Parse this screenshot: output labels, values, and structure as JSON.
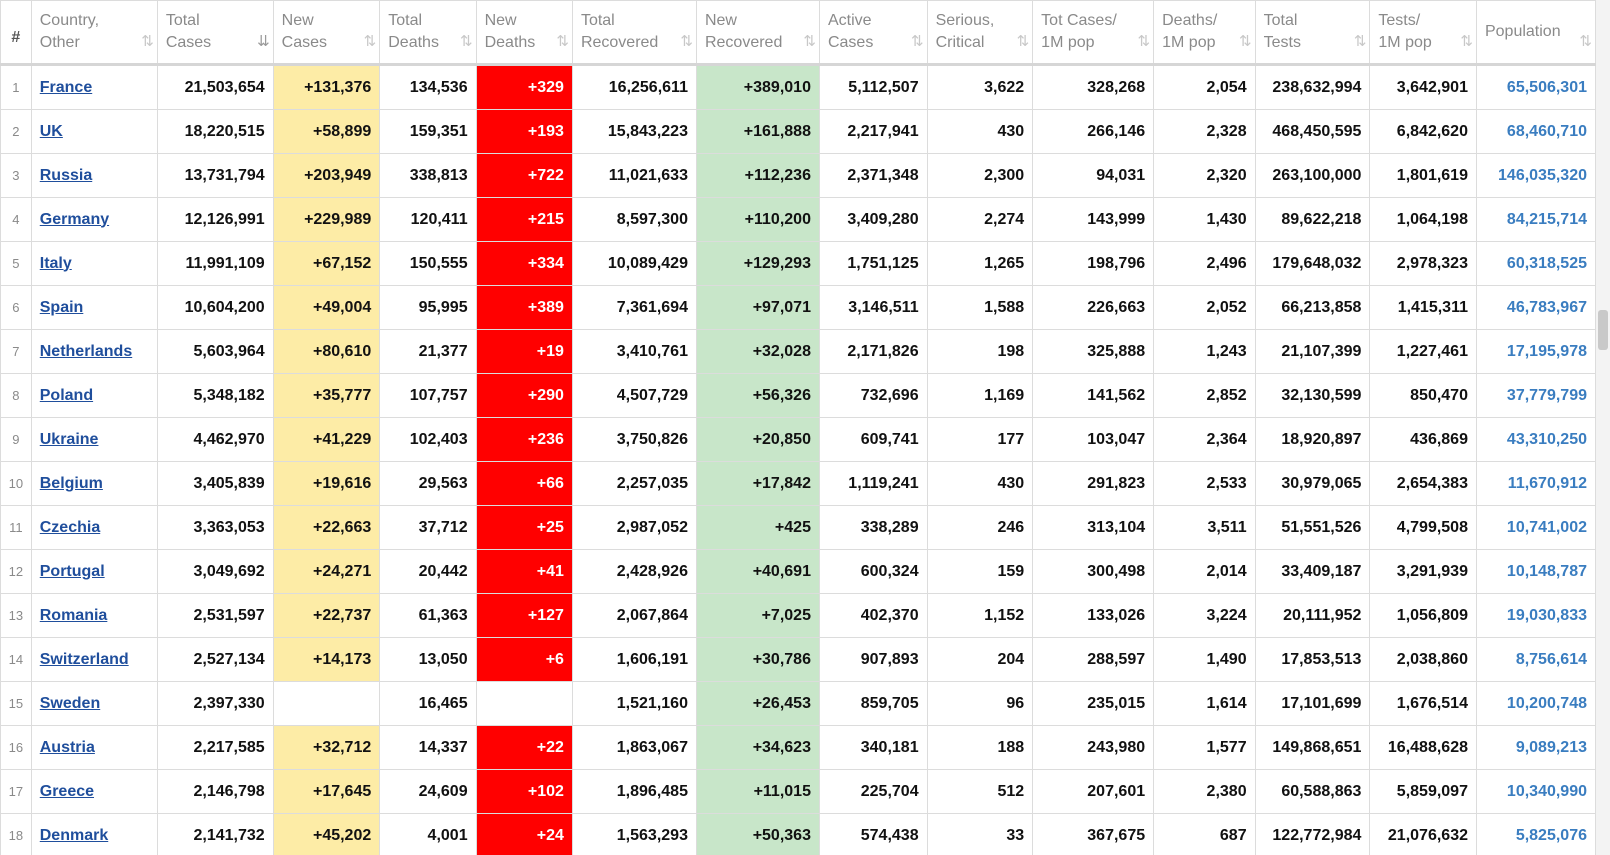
{
  "table": {
    "headers": [
      {
        "line1": "#",
        "line2": ""
      },
      {
        "line1": "Country,",
        "line2": "Other"
      },
      {
        "line1": "Total",
        "line2": "Cases"
      },
      {
        "line1": "New",
        "line2": "Cases"
      },
      {
        "line1": "Total",
        "line2": "Deaths"
      },
      {
        "line1": "New",
        "line2": "Deaths"
      },
      {
        "line1": "Total",
        "line2": "Recovered"
      },
      {
        "line1": "New",
        "line2": "Recovered"
      },
      {
        "line1": "Active",
        "line2": "Cases"
      },
      {
        "line1": "Serious,",
        "line2": "Critical"
      },
      {
        "line1": "Tot Cases/",
        "line2": "1M pop"
      },
      {
        "line1": "Deaths/",
        "line2": "1M pop"
      },
      {
        "line1": "Total",
        "line2": "Tests"
      },
      {
        "line1": "Tests/",
        "line2": "1M pop"
      },
      {
        "line1": "Population",
        "line2": ""
      }
    ],
    "sort_icon": "⇅",
    "active_sort_icon": "⇊",
    "active_sort_column": "Total Cases",
    "rows": [
      {
        "index": "1",
        "country": "France",
        "total_cases": "21,503,654",
        "new_cases": "+131,376",
        "total_deaths": "134,536",
        "new_deaths": "+329",
        "total_recovered": "16,256,611",
        "new_recovered": "+389,010",
        "active_cases": "5,112,507",
        "serious": "3,622",
        "cases_per_1m": "328,268",
        "deaths_per_1m": "2,054",
        "total_tests": "238,632,994",
        "tests_per_1m": "3,642,901",
        "population": "65,506,301"
      },
      {
        "index": "2",
        "country": "UK",
        "total_cases": "18,220,515",
        "new_cases": "+58,899",
        "total_deaths": "159,351",
        "new_deaths": "+193",
        "total_recovered": "15,843,223",
        "new_recovered": "+161,888",
        "active_cases": "2,217,941",
        "serious": "430",
        "cases_per_1m": "266,146",
        "deaths_per_1m": "2,328",
        "total_tests": "468,450,595",
        "tests_per_1m": "6,842,620",
        "population": "68,460,710"
      },
      {
        "index": "3",
        "country": "Russia",
        "total_cases": "13,731,794",
        "new_cases": "+203,949",
        "total_deaths": "338,813",
        "new_deaths": "+722",
        "total_recovered": "11,021,633",
        "new_recovered": "+112,236",
        "active_cases": "2,371,348",
        "serious": "2,300",
        "cases_per_1m": "94,031",
        "deaths_per_1m": "2,320",
        "total_tests": "263,100,000",
        "tests_per_1m": "1,801,619",
        "population": "146,035,320"
      },
      {
        "index": "4",
        "country": "Germany",
        "total_cases": "12,126,991",
        "new_cases": "+229,989",
        "total_deaths": "120,411",
        "new_deaths": "+215",
        "total_recovered": "8,597,300",
        "new_recovered": "+110,200",
        "active_cases": "3,409,280",
        "serious": "2,274",
        "cases_per_1m": "143,999",
        "deaths_per_1m": "1,430",
        "total_tests": "89,622,218",
        "tests_per_1m": "1,064,198",
        "population": "84,215,714"
      },
      {
        "index": "5",
        "country": "Italy",
        "total_cases": "11,991,109",
        "new_cases": "+67,152",
        "total_deaths": "150,555",
        "new_deaths": "+334",
        "total_recovered": "10,089,429",
        "new_recovered": "+129,293",
        "active_cases": "1,751,125",
        "serious": "1,265",
        "cases_per_1m": "198,796",
        "deaths_per_1m": "2,496",
        "total_tests": "179,648,032",
        "tests_per_1m": "2,978,323",
        "population": "60,318,525"
      },
      {
        "index": "6",
        "country": "Spain",
        "total_cases": "10,604,200",
        "new_cases": "+49,004",
        "total_deaths": "95,995",
        "new_deaths": "+389",
        "total_recovered": "7,361,694",
        "new_recovered": "+97,071",
        "active_cases": "3,146,511",
        "serious": "1,588",
        "cases_per_1m": "226,663",
        "deaths_per_1m": "2,052",
        "total_tests": "66,213,858",
        "tests_per_1m": "1,415,311",
        "population": "46,783,967"
      },
      {
        "index": "7",
        "country": "Netherlands",
        "total_cases": "5,603,964",
        "new_cases": "+80,610",
        "total_deaths": "21,377",
        "new_deaths": "+19",
        "total_recovered": "3,410,761",
        "new_recovered": "+32,028",
        "active_cases": "2,171,826",
        "serious": "198",
        "cases_per_1m": "325,888",
        "deaths_per_1m": "1,243",
        "total_tests": "21,107,399",
        "tests_per_1m": "1,227,461",
        "population": "17,195,978"
      },
      {
        "index": "8",
        "country": "Poland",
        "total_cases": "5,348,182",
        "new_cases": "+35,777",
        "total_deaths": "107,757",
        "new_deaths": "+290",
        "total_recovered": "4,507,729",
        "new_recovered": "+56,326",
        "active_cases": "732,696",
        "serious": "1,169",
        "cases_per_1m": "141,562",
        "deaths_per_1m": "2,852",
        "total_tests": "32,130,599",
        "tests_per_1m": "850,470",
        "population": "37,779,799"
      },
      {
        "index": "9",
        "country": "Ukraine",
        "total_cases": "4,462,970",
        "new_cases": "+41,229",
        "total_deaths": "102,403",
        "new_deaths": "+236",
        "total_recovered": "3,750,826",
        "new_recovered": "+20,850",
        "active_cases": "609,741",
        "serious": "177",
        "cases_per_1m": "103,047",
        "deaths_per_1m": "2,364",
        "total_tests": "18,920,897",
        "tests_per_1m": "436,869",
        "population": "43,310,250"
      },
      {
        "index": "10",
        "country": "Belgium",
        "total_cases": "3,405,839",
        "new_cases": "+19,616",
        "total_deaths": "29,563",
        "new_deaths": "+66",
        "total_recovered": "2,257,035",
        "new_recovered": "+17,842",
        "active_cases": "1,119,241",
        "serious": "430",
        "cases_per_1m": "291,823",
        "deaths_per_1m": "2,533",
        "total_tests": "30,979,065",
        "tests_per_1m": "2,654,383",
        "population": "11,670,912"
      },
      {
        "index": "11",
        "country": "Czechia",
        "total_cases": "3,363,053",
        "new_cases": "+22,663",
        "total_deaths": "37,712",
        "new_deaths": "+25",
        "total_recovered": "2,987,052",
        "new_recovered": "+425",
        "active_cases": "338,289",
        "serious": "246",
        "cases_per_1m": "313,104",
        "deaths_per_1m": "3,511",
        "total_tests": "51,551,526",
        "tests_per_1m": "4,799,508",
        "population": "10,741,002"
      },
      {
        "index": "12",
        "country": "Portugal",
        "total_cases": "3,049,692",
        "new_cases": "+24,271",
        "total_deaths": "20,442",
        "new_deaths": "+41",
        "total_recovered": "2,428,926",
        "new_recovered": "+40,691",
        "active_cases": "600,324",
        "serious": "159",
        "cases_per_1m": "300,498",
        "deaths_per_1m": "2,014",
        "total_tests": "33,409,187",
        "tests_per_1m": "3,291,939",
        "population": "10,148,787"
      },
      {
        "index": "13",
        "country": "Romania",
        "total_cases": "2,531,597",
        "new_cases": "+22,737",
        "total_deaths": "61,363",
        "new_deaths": "+127",
        "total_recovered": "2,067,864",
        "new_recovered": "+7,025",
        "active_cases": "402,370",
        "serious": "1,152",
        "cases_per_1m": "133,026",
        "deaths_per_1m": "3,224",
        "total_tests": "20,111,952",
        "tests_per_1m": "1,056,809",
        "population": "19,030,833"
      },
      {
        "index": "14",
        "country": "Switzerland",
        "total_cases": "2,527,134",
        "new_cases": "+14,173",
        "total_deaths": "13,050",
        "new_deaths": "+6",
        "total_recovered": "1,606,191",
        "new_recovered": "+30,786",
        "active_cases": "907,893",
        "serious": "204",
        "cases_per_1m": "288,597",
        "deaths_per_1m": "1,490",
        "total_tests": "17,853,513",
        "tests_per_1m": "2,038,860",
        "population": "8,756,614"
      },
      {
        "index": "15",
        "country": "Sweden",
        "total_cases": "2,397,330",
        "new_cases": "",
        "total_deaths": "16,465",
        "new_deaths": "",
        "total_recovered": "1,521,160",
        "new_recovered": "+26,453",
        "active_cases": "859,705",
        "serious": "96",
        "cases_per_1m": "235,015",
        "deaths_per_1m": "1,614",
        "total_tests": "17,101,699",
        "tests_per_1m": "1,676,514",
        "population": "10,200,748"
      },
      {
        "index": "16",
        "country": "Austria",
        "total_cases": "2,217,585",
        "new_cases": "+32,712",
        "total_deaths": "14,337",
        "new_deaths": "+22",
        "total_recovered": "1,863,067",
        "new_recovered": "+34,623",
        "active_cases": "340,181",
        "serious": "188",
        "cases_per_1m": "243,980",
        "deaths_per_1m": "1,577",
        "total_tests": "149,868,651",
        "tests_per_1m": "16,488,628",
        "population": "9,089,213"
      },
      {
        "index": "17",
        "country": "Greece",
        "total_cases": "2,146,798",
        "new_cases": "+17,645",
        "total_deaths": "24,609",
        "new_deaths": "+102",
        "total_recovered": "1,896,485",
        "new_recovered": "+11,015",
        "active_cases": "225,704",
        "serious": "512",
        "cases_per_1m": "207,601",
        "deaths_per_1m": "2,380",
        "total_tests": "60,588,863",
        "tests_per_1m": "5,859,097",
        "population": "10,340,990"
      },
      {
        "index": "18",
        "country": "Denmark",
        "total_cases": "2,141,732",
        "new_cases": "+45,202",
        "total_deaths": "4,001",
        "new_deaths": "+24",
        "total_recovered": "1,563,293",
        "new_recovered": "+50,363",
        "active_cases": "574,438",
        "serious": "33",
        "cases_per_1m": "367,675",
        "deaths_per_1m": "687",
        "total_tests": "122,772,984",
        "tests_per_1m": "21,076,632",
        "population": "5,825,076"
      }
    ]
  },
  "colors": {
    "new_cases_bg": "#fdeca6",
    "new_deaths_bg": "#ff0000",
    "new_recovered_bg": "#c8e6c9",
    "country_link": "#1f4e9c",
    "population_link": "#3a7dc0"
  }
}
